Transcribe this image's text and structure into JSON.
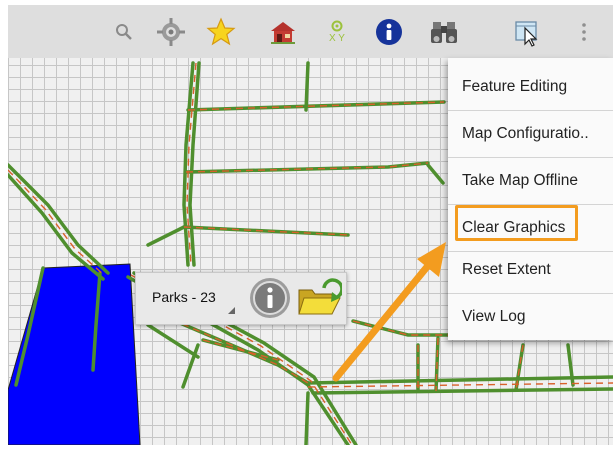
{
  "toolbar": {
    "icons": [
      "search-icon",
      "gps-locate-icon",
      "bookmark-star-icon",
      "basemap-icon",
      "xy-coordinates-icon",
      "info-icon",
      "binoculars-icon",
      "select-cursor-icon",
      "overflow-menu-icon"
    ],
    "xy_label": "X Y"
  },
  "menu": {
    "items": [
      "Feature Editing",
      "Map Configuratio..",
      "Take Map Offline",
      "Clear Graphics",
      "Reset Extent",
      "View Log"
    ],
    "highlighted": "Clear Graphics"
  },
  "callout": {
    "label": "Parks - 23"
  },
  "colors": {
    "road_line": "#4f8f2e",
    "road_dash": "#d9612b",
    "polygon": "#0000ff",
    "highlight": "#f39c1f",
    "arrow": "#f39c1f"
  }
}
